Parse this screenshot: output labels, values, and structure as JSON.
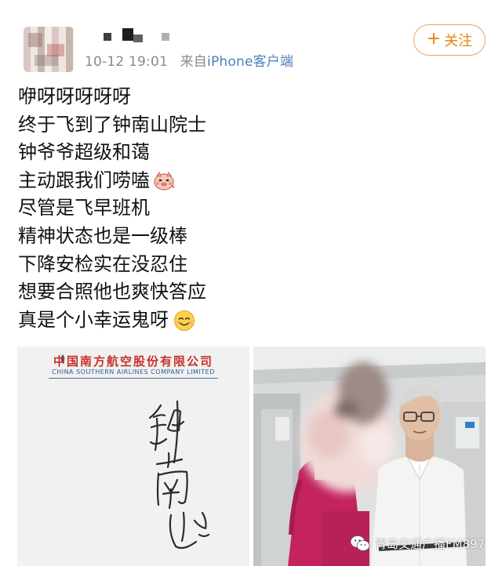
{
  "post": {
    "author": {
      "avatar_icon": "blurred-avatar",
      "name_hidden": true
    },
    "meta": {
      "timestamp": "10-12 19:01",
      "source_prefix": "来自",
      "source": "iPhone客户端"
    },
    "follow_button": {
      "plus": "+",
      "label": "关注"
    },
    "lines": [
      "咿呀呀呀呀呀",
      "终于飞到了钟南山院士",
      "钟爷爷超级和蔼",
      "主动跟我们唠嗑",
      "尽管是飞早班机",
      "精神状态也是一级棒",
      "下降安检实在没忍住",
      "想要合照他也爽快答应",
      "真是个小幸运鬼呀"
    ],
    "emojis": {
      "line_4": "blushing-pig-emoji",
      "line_9": "smiling-face-emoji"
    },
    "images": {
      "left": {
        "company_cn": "中国南方航空股份有限公司",
        "company_en": "CHINA SOUTHERN AIRLINES COMPANY LIMITED",
        "signature": "handwritten-signature"
      },
      "right": {
        "description_icon": "photo-in-aircraft-cabin"
      }
    },
    "watermark": {
      "icon": "wechat-icon",
      "text": "青岛交通广播FM897"
    }
  },
  "colors": {
    "accent_orange": "#e8830a",
    "link_blue": "#4d7fb8",
    "airline_red": "#c5312f",
    "airline_blue": "#2d5a9a"
  }
}
